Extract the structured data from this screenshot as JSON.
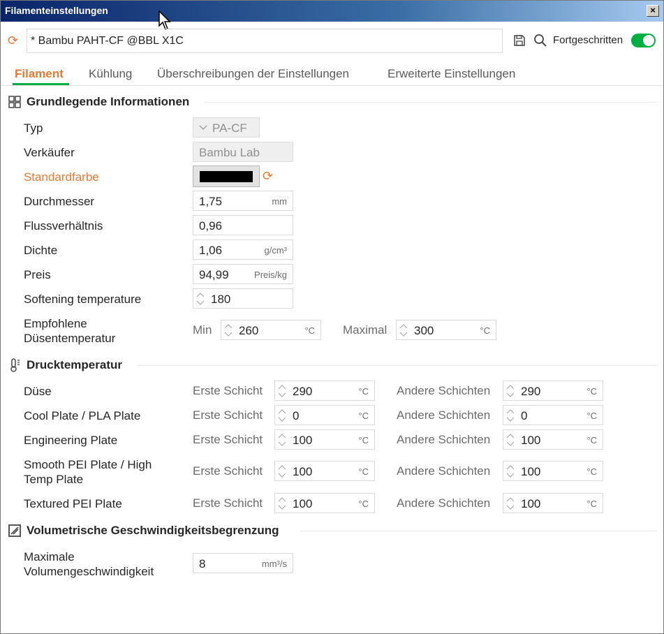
{
  "window": {
    "title": "Filamenteinstellungen",
    "close_label": "×"
  },
  "preset": {
    "name": "* Bambu PAHT-CF @BBL X1C",
    "advanced_label": "Fortgeschritten",
    "advanced_on": true
  },
  "tabs": [
    {
      "label": "Filament",
      "active": true
    },
    {
      "label": "Kühlung",
      "active": false
    },
    {
      "label": "Überschreibungen der Einstellungen",
      "active": false
    },
    {
      "label": "Erweiterte Einstellungen",
      "active": false
    }
  ],
  "colors": {
    "accent": "#00ae42",
    "modified": "#e57a33",
    "default_color": "#000000"
  },
  "basic": {
    "title": "Grundlegende Informationen",
    "type_label": "Typ",
    "type_value": "PA-CF",
    "vendor_label": "Verkäufer",
    "vendor_value": "Bambu Lab",
    "color_label": "Standardfarbe",
    "diameter_label": "Durchmesser",
    "diameter_value": "1,75",
    "diameter_unit": "mm",
    "flow_label": "Flussverhältnis",
    "flow_value": "0,96",
    "density_label": "Dichte",
    "density_value": "1,06",
    "density_unit": "g/cm³",
    "price_label": "Preis",
    "price_value": "94,99",
    "price_unit": "Preis/kg",
    "softening_label": "Softening temperature",
    "softening_value": "180",
    "nozzle_temp_label_1": "Empfohlene",
    "nozzle_temp_label_2": "Düsentemperatur",
    "min_label": "Min",
    "min_value": "260",
    "min_unit": "°C",
    "max_label": "Maximal",
    "max_value": "300",
    "max_unit": "°C"
  },
  "print_temp": {
    "title": "Drucktemperatur",
    "first_label": "Erste Schicht",
    "other_label": "Andere Schichten",
    "unit": "°C",
    "rows": [
      {
        "label": "Düse",
        "first": "290",
        "other": "290"
      },
      {
        "label": "Cool Plate / PLA Plate",
        "first": "0",
        "other": "0"
      },
      {
        "label": "Engineering Plate",
        "first": "100",
        "other": "100"
      },
      {
        "label_1": "Smooth PEI Plate / High",
        "label_2": "Temp Plate",
        "first": "100",
        "other": "100"
      },
      {
        "label": "Textured PEI Plate",
        "first": "100",
        "other": "100"
      }
    ]
  },
  "volumetric": {
    "title": "Volumetrische Geschwindigkeitsbegrenzung",
    "label_1": "Maximale",
    "label_2": "Volumengeschwindigkeit",
    "value": "8",
    "unit": "mm³/s"
  }
}
